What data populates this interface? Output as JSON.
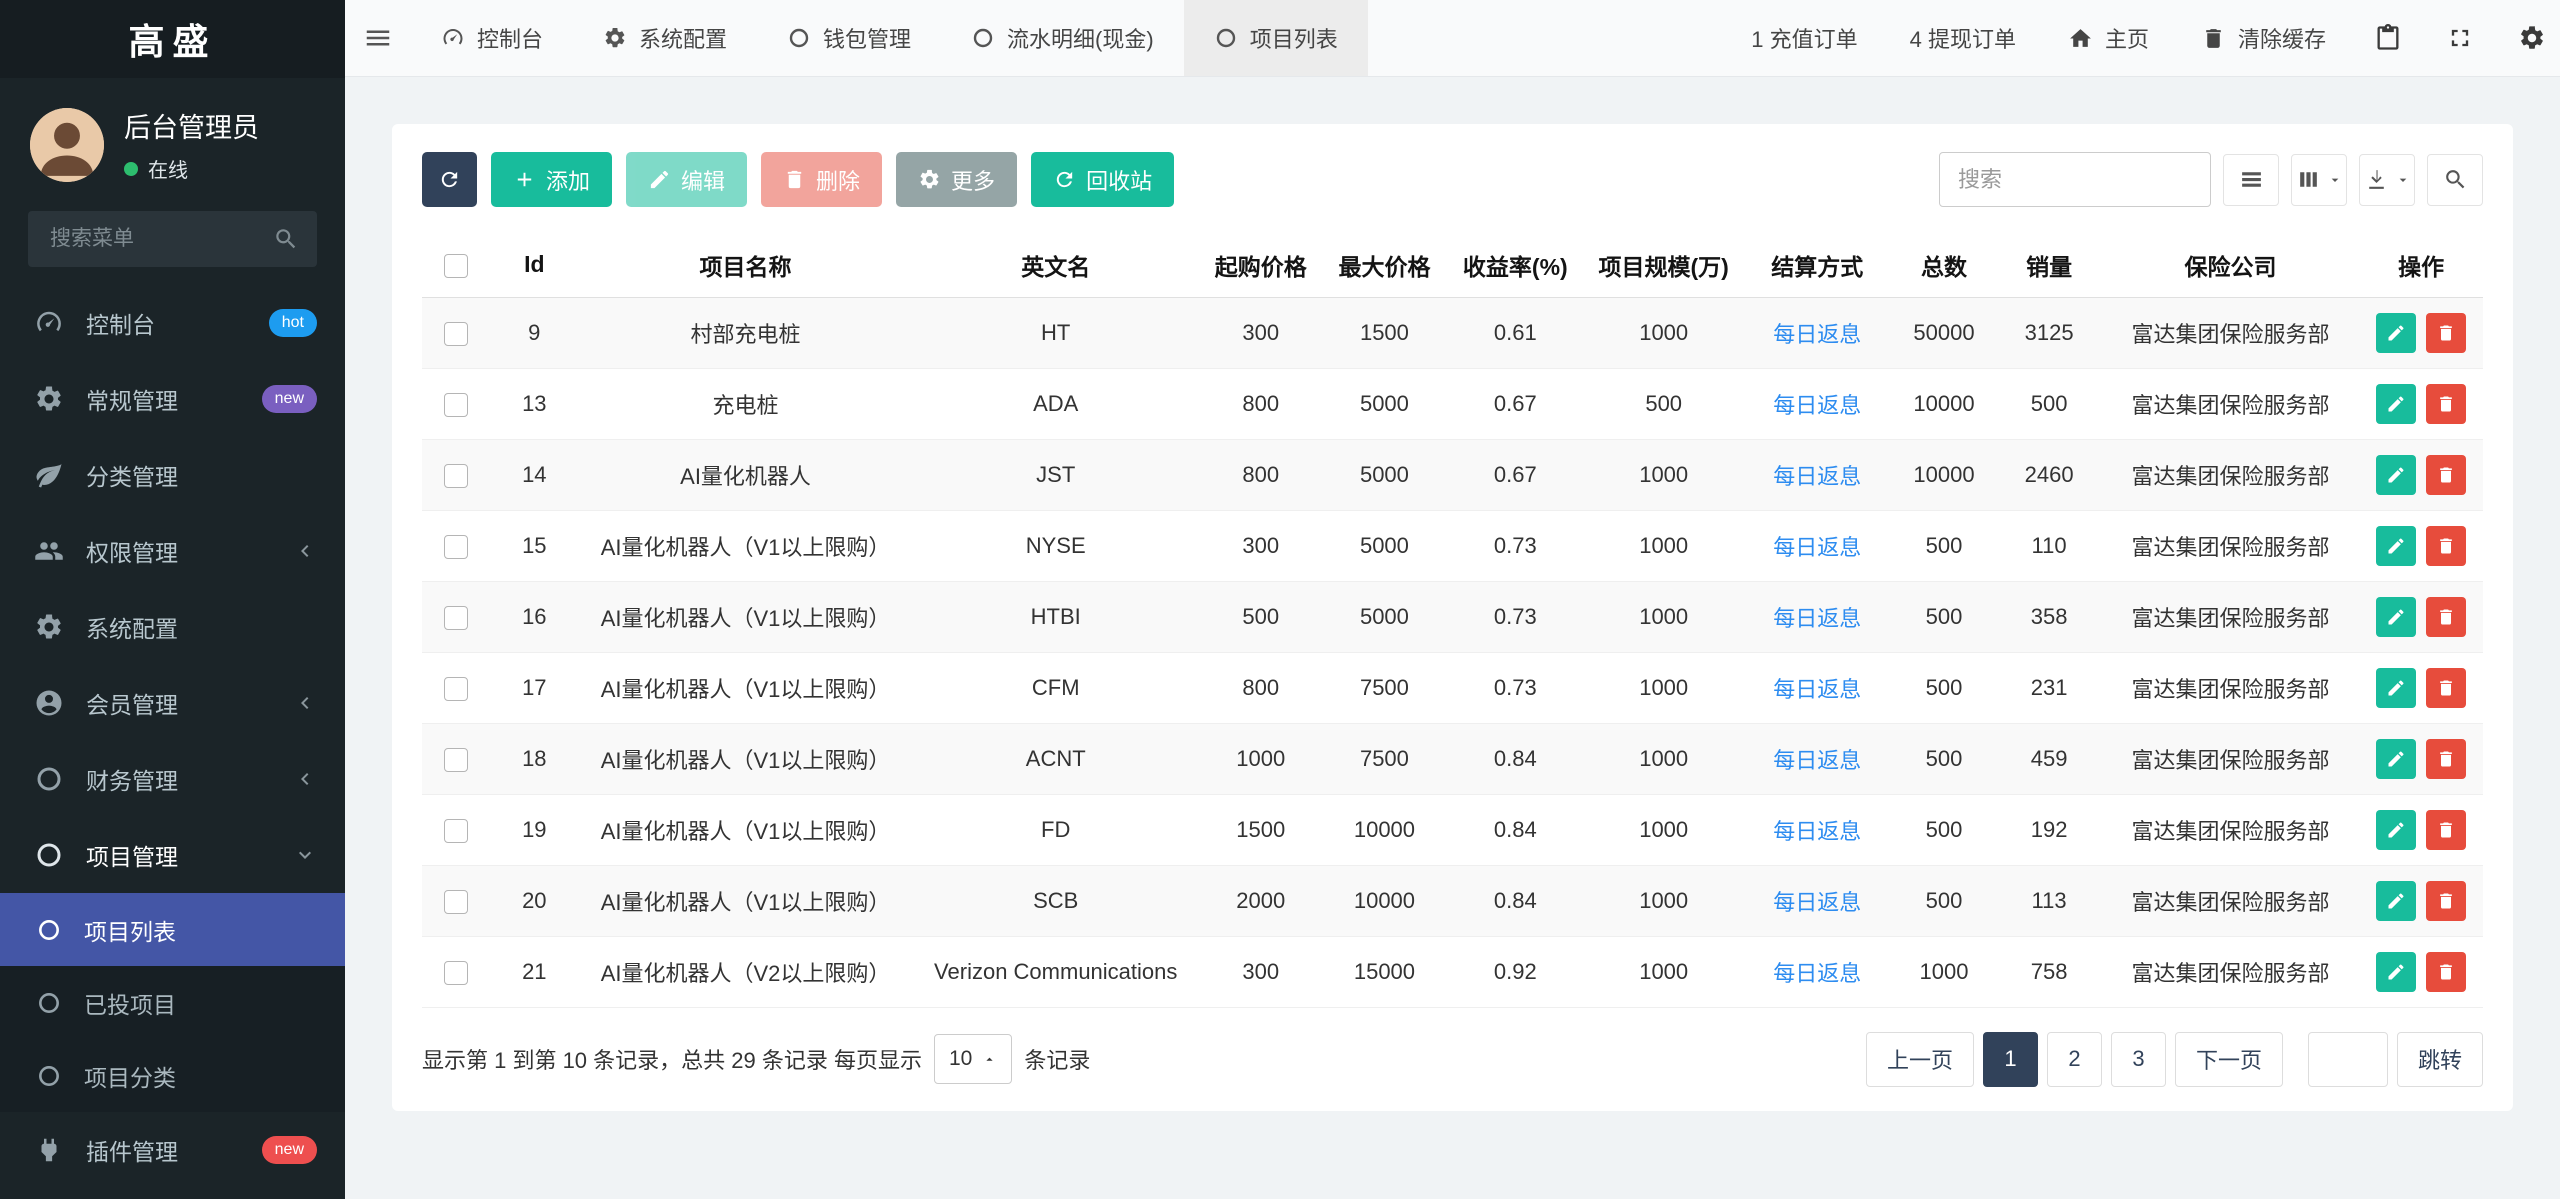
{
  "brand": "高盛",
  "user": {
    "name": "后台管理员",
    "status": "在线"
  },
  "sidebar": {
    "search_placeholder": "搜索菜单",
    "items": [
      {
        "key": "dashboard",
        "icon": "gauge",
        "label": "控制台",
        "badge": "hot",
        "badge_color": "#1d9cf0"
      },
      {
        "key": "general",
        "icon": "gear",
        "label": "常规管理",
        "badge": "new",
        "badge_color": "#7a5fc0"
      },
      {
        "key": "category",
        "icon": "leaf",
        "label": "分类管理"
      },
      {
        "key": "auth",
        "icon": "users",
        "label": "权限管理",
        "arrow": "left"
      },
      {
        "key": "config",
        "icon": "gear",
        "label": "系统配置"
      },
      {
        "key": "member",
        "icon": "user-circle",
        "label": "会员管理",
        "arrow": "left"
      },
      {
        "key": "finance",
        "icon": "circle",
        "label": "财务管理",
        "arrow": "left"
      },
      {
        "key": "project",
        "icon": "circle",
        "label": "项目管理",
        "arrow": "down",
        "open": true,
        "children": [
          {
            "key": "project-list",
            "label": "项目列表",
            "active": true
          },
          {
            "key": "invested-projects",
            "label": "已投项目"
          },
          {
            "key": "project-category",
            "label": "项目分类"
          }
        ]
      },
      {
        "key": "addon",
        "icon": "plug",
        "label": "插件管理",
        "badge": "new",
        "badge_color": "#ee4f4f"
      }
    ]
  },
  "topbar": {
    "tabs": [
      {
        "key": "dashboard",
        "icon": "gauge",
        "label": "控制台"
      },
      {
        "key": "config",
        "icon": "gear",
        "label": "系统配置"
      },
      {
        "key": "wallet",
        "icon": "circle",
        "label": "钱包管理"
      },
      {
        "key": "money-flow",
        "icon": "circle",
        "label": "流水明细(现金)"
      },
      {
        "key": "project-list",
        "icon": "circle",
        "label": "项目列表",
        "active": true
      }
    ],
    "shortcuts": [
      {
        "key": "recharge-orders",
        "label": "1 充值订单"
      },
      {
        "key": "withdraw-orders",
        "label": "4 提现订单"
      },
      {
        "key": "home",
        "icon": "home",
        "label": "主页"
      },
      {
        "key": "clear-cache",
        "icon": "trash",
        "label": "清除缓存"
      }
    ]
  },
  "toolbar": {
    "add": "添加",
    "edit": "编辑",
    "delete": "删除",
    "more": "更多",
    "recycle": "回收站",
    "search_placeholder": "搜索"
  },
  "table": {
    "columns": [
      "Id",
      "项目名称",
      "英文名",
      "起购价格",
      "最大价格",
      "收益率(%)",
      "项目规模(万)",
      "结算方式",
      "总数",
      "销量",
      "保险公司",
      "操作"
    ],
    "rows": [
      {
        "id": "9",
        "name": "村部充电桩",
        "en": "HT",
        "min_price": "300",
        "max_price": "1500",
        "rate": "0.61",
        "scale": "1000",
        "settle": "每日返息",
        "total": "50000",
        "sales": "3125",
        "insurer": "富达集团保险服务部"
      },
      {
        "id": "13",
        "name": "充电桩",
        "en": "ADA",
        "min_price": "800",
        "max_price": "5000",
        "rate": "0.67",
        "scale": "500",
        "settle": "每日返息",
        "total": "10000",
        "sales": "500",
        "insurer": "富达集团保险服务部"
      },
      {
        "id": "14",
        "name": "AI量化机器人",
        "en": "JST",
        "min_price": "800",
        "max_price": "5000",
        "rate": "0.67",
        "scale": "1000",
        "settle": "每日返息",
        "total": "10000",
        "sales": "2460",
        "insurer": "富达集团保险服务部"
      },
      {
        "id": "15",
        "name": "AI量化机器人（V1以上限购）",
        "en": "NYSE",
        "min_price": "300",
        "max_price": "5000",
        "rate": "0.73",
        "scale": "1000",
        "settle": "每日返息",
        "total": "500",
        "sales": "110",
        "insurer": "富达集团保险服务部"
      },
      {
        "id": "16",
        "name": "AI量化机器人（V1以上限购）",
        "en": "HTBI",
        "min_price": "500",
        "max_price": "5000",
        "rate": "0.73",
        "scale": "1000",
        "settle": "每日返息",
        "total": "500",
        "sales": "358",
        "insurer": "富达集团保险服务部"
      },
      {
        "id": "17",
        "name": "AI量化机器人（V1以上限购）",
        "en": "CFM",
        "min_price": "800",
        "max_price": "7500",
        "rate": "0.73",
        "scale": "1000",
        "settle": "每日返息",
        "total": "500",
        "sales": "231",
        "insurer": "富达集团保险服务部"
      },
      {
        "id": "18",
        "name": "AI量化机器人（V1以上限购）",
        "en": "ACNT",
        "min_price": "1000",
        "max_price": "7500",
        "rate": "0.84",
        "scale": "1000",
        "settle": "每日返息",
        "total": "500",
        "sales": "459",
        "insurer": "富达集团保险服务部"
      },
      {
        "id": "19",
        "name": "AI量化机器人（V1以上限购）",
        "en": "FD",
        "min_price": "1500",
        "max_price": "10000",
        "rate": "0.84",
        "scale": "1000",
        "settle": "每日返息",
        "total": "500",
        "sales": "192",
        "insurer": "富达集团保险服务部"
      },
      {
        "id": "20",
        "name": "AI量化机器人（V1以上限购）",
        "en": "SCB",
        "min_price": "2000",
        "max_price": "10000",
        "rate": "0.84",
        "scale": "1000",
        "settle": "每日返息",
        "total": "500",
        "sales": "113",
        "insurer": "富达集团保险服务部"
      },
      {
        "id": "21",
        "name": "AI量化机器人（V2以上限购）",
        "en": "Verizon Communications",
        "min_price": "300",
        "max_price": "15000",
        "rate": "0.92",
        "scale": "1000",
        "settle": "每日返息",
        "total": "1000",
        "sales": "758",
        "insurer": "富达集团保险服务部"
      }
    ]
  },
  "footer": {
    "summary": "显示第 1 到第 10 条记录，总共 29 条记录 每页显示",
    "page_size": "10",
    "summary_suffix": "条记录",
    "prev": "上一页",
    "pages": [
      "1",
      "2",
      "3"
    ],
    "active_page": "1",
    "next": "下一页",
    "jump": "跳转"
  },
  "colors": {
    "sidebar_bg": "#1b2428",
    "active_menu": "#4456a6",
    "accent": "#31425a",
    "success": "#18bc9c",
    "danger": "#e74c3c",
    "link": "#2d8cf0",
    "badge_hot": "#1d9cf0",
    "badge_new_purple": "#7a5fc0",
    "badge_new_red": "#ee4f4f"
  }
}
